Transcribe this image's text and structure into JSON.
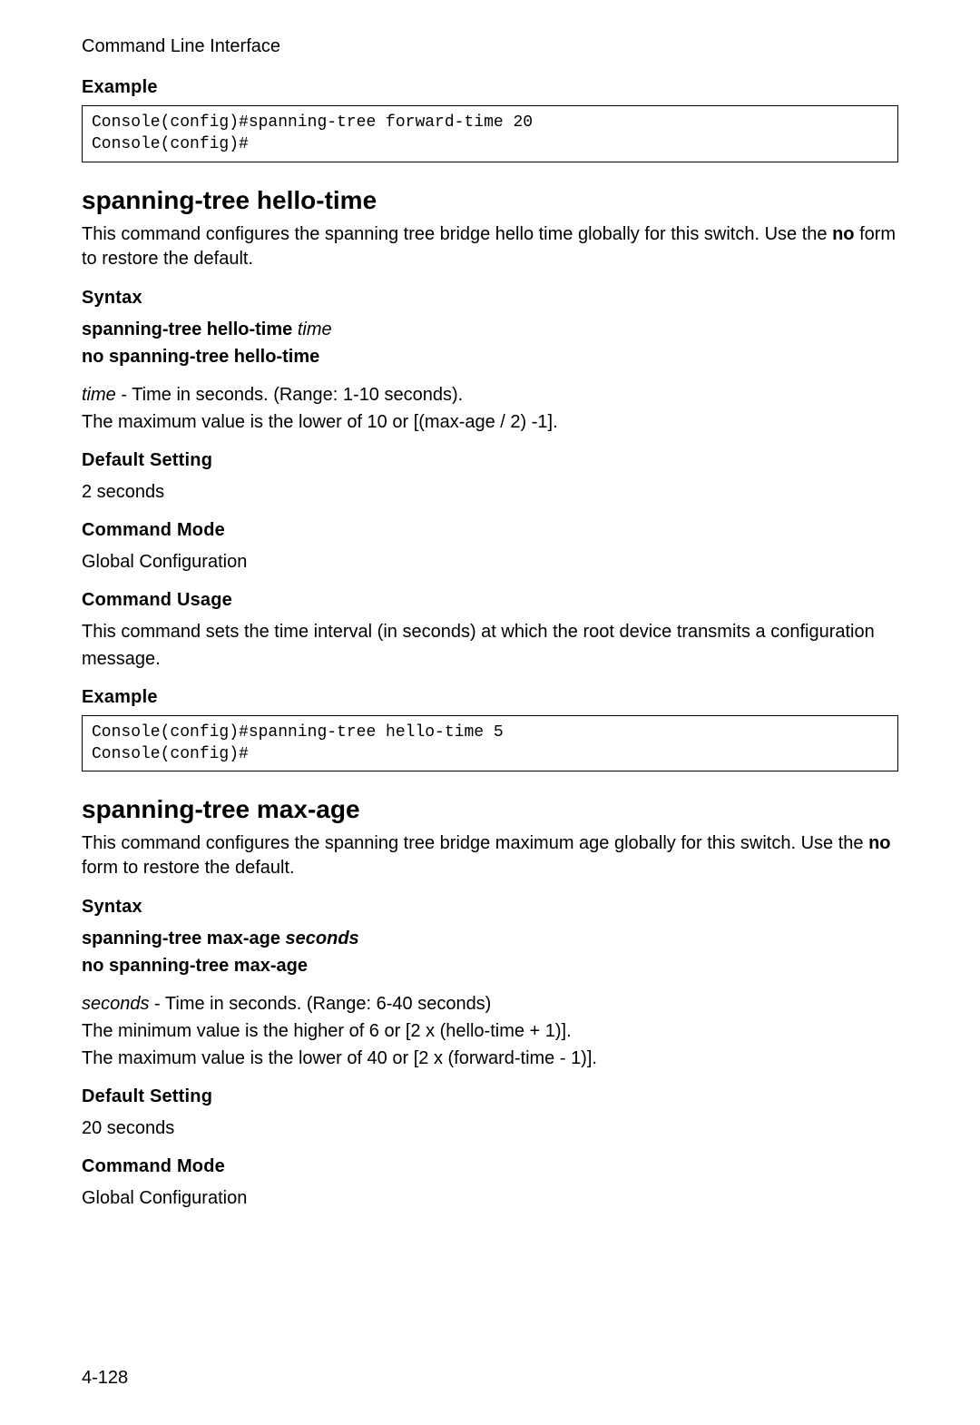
{
  "running_head": "Command Line Interface",
  "page_number": "4-128",
  "top": {
    "example_label": "Example",
    "code": "Console(config)#spanning-tree forward-time 20\nConsole(config)#"
  },
  "cmd1": {
    "title": "spanning-tree hello-time",
    "intro_pre": "This command configures the spanning tree bridge hello time globally for this switch. Use the ",
    "intro_strong": "no",
    "intro_post": " form to restore the default.",
    "syntax_label": "Syntax",
    "syn_line1_cmd": "spanning-tree hello-time ",
    "syn_line1_arg": "time",
    "syn_line2": "no spanning-tree hello-time",
    "param_name": "time",
    "param_desc": " - Time in seconds. (Range: 1-10 seconds).",
    "param_extra": "The maximum value is the lower of 10 or [(max-age / 2) -1].",
    "default_label": "Default Setting",
    "default_value": "2 seconds",
    "mode_label": "Command Mode",
    "mode_value": "Global Configuration",
    "usage_label": "Command Usage",
    "usage_text": "This command sets the time interval (in seconds) at which the root device transmits a configuration message.",
    "example_label": "Example",
    "code": "Console(config)#spanning-tree hello-time 5\nConsole(config)#"
  },
  "cmd2": {
    "title": "spanning-tree max-age",
    "intro_pre": "This command configures the spanning tree bridge maximum age globally for this switch. Use the ",
    "intro_strong": "no",
    "intro_post": " form to restore the default.",
    "syntax_label": "Syntax",
    "syn_line1_cmd": "spanning-tree max-age ",
    "syn_line1_arg": "seconds",
    "syn_line2": "no spanning-tree max-age",
    "param_name": "seconds",
    "param_desc": " - Time in seconds. (Range: 6-40 seconds)",
    "param_extra1": "The minimum value is the higher of 6 or [2 x (hello-time + 1)].",
    "param_extra2": "The maximum value is the lower of 40 or [2 x (forward-time - 1)].",
    "default_label": "Default Setting",
    "default_value": "20 seconds",
    "mode_label": "Command Mode",
    "mode_value": "Global Configuration"
  }
}
